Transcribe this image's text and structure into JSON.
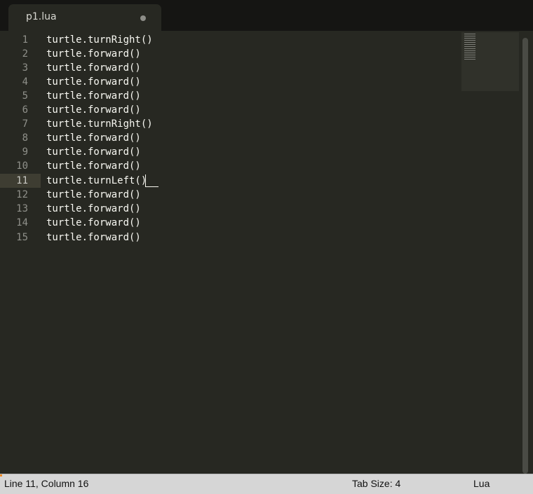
{
  "tab": {
    "title": "p1.lua"
  },
  "editor": {
    "lines": [
      {
        "number": "1",
        "code": "turtle.turnRight()"
      },
      {
        "number": "2",
        "code": "turtle.forward()"
      },
      {
        "number": "3",
        "code": "turtle.forward()"
      },
      {
        "number": "4",
        "code": "turtle.forward()"
      },
      {
        "number": "5",
        "code": "turtle.forward()"
      },
      {
        "number": "6",
        "code": "turtle.forward()"
      },
      {
        "number": "7",
        "code": "turtle.turnRight()"
      },
      {
        "number": "8",
        "code": "turtle.forward()"
      },
      {
        "number": "9",
        "code": "turtle.forward()"
      },
      {
        "number": "10",
        "code": "turtle.forward()"
      },
      {
        "number": "11",
        "code": "turtle.turnLeft()"
      },
      {
        "number": "12",
        "code": "turtle.forward()"
      },
      {
        "number": "13",
        "code": "turtle.forward()"
      },
      {
        "number": "14",
        "code": "turtle.forward()"
      },
      {
        "number": "15",
        "code": "turtle.forward()"
      }
    ],
    "active_line": 11,
    "cursor_column": 16
  },
  "status": {
    "position": "Line 11, Column 16",
    "tab_size": "Tab Size: 4",
    "language": "Lua"
  },
  "colors": {
    "background": "#272822",
    "text": "#f8f8f2",
    "gutter_text": "#8f908a",
    "accent": "#f08a24"
  }
}
